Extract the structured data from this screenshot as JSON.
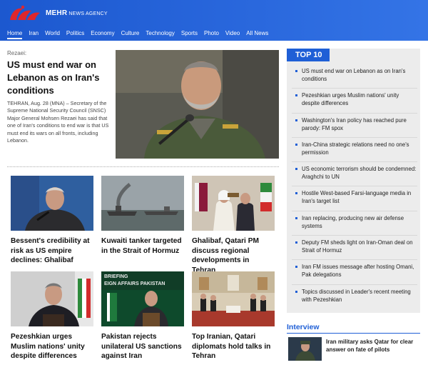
{
  "header": {
    "brand_main": "MEHR",
    "brand_sub": " NEWS AGENCY",
    "nav": [
      "Home",
      "Iran",
      "World",
      "Politics",
      "Economy",
      "Culture",
      "Technology",
      "Sports",
      "Photo",
      "Video",
      "All News"
    ]
  },
  "lead": {
    "kicker": "Rezaei:",
    "title": "US must end war on Lebanon as on Iran's conditions",
    "summary": "TEHRAN, Aug. 28 (MNA) – Secretary of the Supreme National Security Council (SNSC) Major General Mohsen Rezaei has said that one of Iran's conditions to end war is that US must end its wars on all fronts, including Lebanon."
  },
  "cards": [
    {
      "title": "Bessent's credibility at risk as US empire declines: Ghalibaf"
    },
    {
      "title": "Kuwaiti tanker targeted in the Strait of Hormuz"
    },
    {
      "title": "Ghalibaf, Qatari PM discuss regional developments in Tehran"
    },
    {
      "title": "Pezeshkian urges Muslim nations' unity despite differences"
    },
    {
      "title": "Pakistan rejects unilateral US sanctions against Iran"
    },
    {
      "title": "Top Iranian, Qatari diplomats hold talks in Tehran"
    }
  ],
  "card_image_text": {
    "pakistan_banner": "EIGN AFFAIRS PAKISTAN",
    "pakistan_banner_top": "BRIEFING"
  },
  "top10": {
    "heading": "TOP 10",
    "items": [
      "US must end war on Lebanon as on Iran's conditions",
      "Pezeshkian urges Muslim nations' unity despite differences",
      "Washington's Iran policy has reached pure parody: FM spox",
      "Iran-China strategic relations need no one's permission",
      "US economic terrorism should be condemned: Araghchi to UN",
      "Hostile West-based Farsi-language media in Iran's target list",
      "Iran replacing, producing new air defense systems",
      "Deputy FM sheds light on Iran-Oman deal on Strait of Hormuz",
      "Iran FM issues message after hosting Omani, Pak delegations",
      "Topics discussed in Leader's recent meeting with Pezeshkian"
    ]
  },
  "interview": {
    "label": "Interview",
    "title": "Iran military asks Qatar for clear answer on fate of pilots"
  },
  "colors": {
    "brand_blue": "#1f5fd6",
    "logo_red": "#e0262b",
    "panel_gray": "#ececec"
  }
}
